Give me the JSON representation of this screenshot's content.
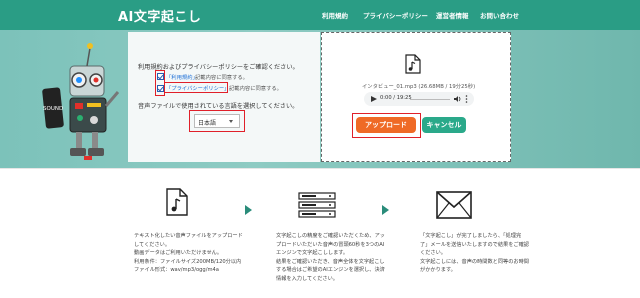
{
  "header": {
    "logo": "AI文字起こし",
    "nav": [
      "利用規約",
      "プライバシーポリシー",
      "運営者情報",
      "お問い合わせ"
    ]
  },
  "form": {
    "consent_text": "利用規約およびプライバシーポリシーをご確認ください。",
    "terms_link": "「利用規約」",
    "terms_suffix": "記載内容に同意する。",
    "privacy_link": "「プライバシーポリシー」",
    "privacy_suffix": "記載内容に同意する。",
    "language_prompt": "音声ファイルで使用されている言語を選択してください。",
    "language_value": "日本語"
  },
  "upload": {
    "file_info": "インタビュー_01.mp3 (26.68MB / 19分25秒)",
    "time": "0:00 / 19:25",
    "upload_label": "アップロード",
    "cancel_label": "キャンセル"
  },
  "robot_label": "SOUND",
  "steps": [
    {
      "lines": [
        "テキスト化したい音声ファイルをアップロード",
        "してください。",
        "動画データはご利用いただけません。",
        "利用条件：ファイルサイズ200MB/120分以内",
        "ファイル形式：wav/mp3/ogg/m4a"
      ]
    },
    {
      "lines": [
        "文字起こしの精度をご確認いただくため、アッ",
        "プロードいただいた音声の冒頭60秒を3つのAI",
        "エンジンで文字起こしします。",
        "結果をご確認いただき、音声全体を文字起こし",
        "する場合はご希望のAIエンジンを選択し、決済",
        "情報を入力してください。"
      ]
    },
    {
      "lines": [
        "「文字起こし」が完了しましたら、「処理完",
        "了」メールを送信いたしますので結果をご確認",
        "ください。",
        "文字起こしには、音声の時間数と同等のお時間",
        "がかかります。"
      ]
    }
  ],
  "colors": {
    "header": "#2a9d85",
    "upload_button": "#ef6a26",
    "cancel_button": "#2aa98a",
    "highlight": "#e0202a"
  }
}
